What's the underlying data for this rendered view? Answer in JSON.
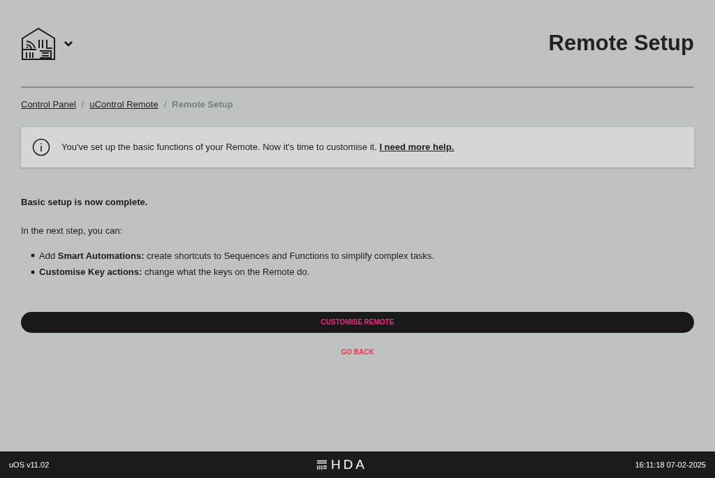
{
  "header": {
    "title": "Remote Setup"
  },
  "breadcrumbs": [
    {
      "label": "Control Panel",
      "selected": false
    },
    {
      "label": "uControl Remote",
      "selected": false
    },
    {
      "label": "Remote Setup",
      "selected": true
    }
  ],
  "breadcrumb_separator": "/",
  "info": {
    "text": "You've set up the basic functions of your Remote. Now it's time to customise it.",
    "link": "I need more help."
  },
  "heading": "Basic setup is now complete.",
  "intro": "In the next step, you can:",
  "bullets": [
    "Add **Smart Automations:** create shortcuts to Sequences and Functions to simplify complex tasks.",
    "**Customise Key actions:** change what the keys on the Remote do."
  ],
  "primary_button": "CUSTOMISE REMOTE",
  "secondary_button": "GO BACK",
  "footer": {
    "version": "uOS v11.02",
    "brand": "HDA",
    "datetime": "16:11:18 07-02-2025"
  }
}
